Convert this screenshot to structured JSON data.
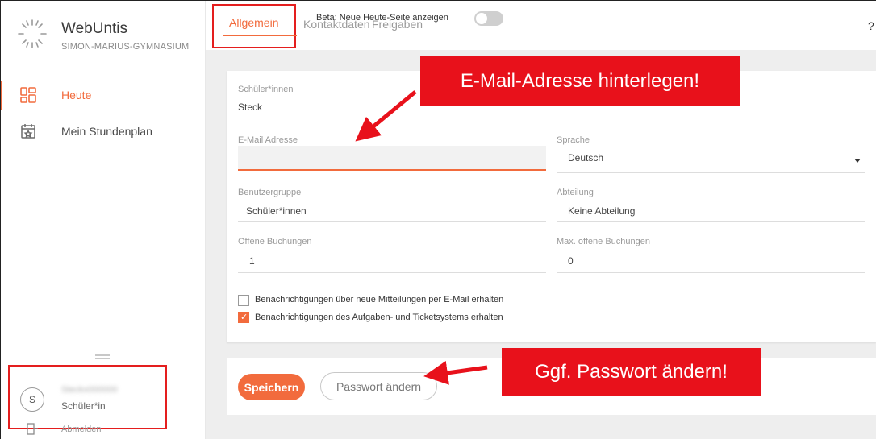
{
  "app": {
    "name": "WebUntis",
    "school": "SIMON-MARIUS-GYMNASIUM"
  },
  "sidebar": {
    "items": [
      {
        "label": "Heute",
        "icon": "dashboard-icon",
        "active": true
      },
      {
        "label": "Mein Stundenplan",
        "icon": "calendar-icon",
        "active": false
      }
    ],
    "user": {
      "avatar_initial": "S",
      "role": "Schüler*in",
      "logout_label": "Abmelden"
    }
  },
  "tabs": [
    {
      "label": "Allgemein",
      "active": true
    },
    {
      "label": "Kontaktdaten",
      "active": false
    },
    {
      "label": "Freigaben",
      "active": false
    }
  ],
  "beta": {
    "label": "Beta: Neue Heute-Seite anzeigen",
    "enabled": false
  },
  "form": {
    "student": {
      "label": "Schüler*innen",
      "value": "Steck"
    },
    "email": {
      "label": "E-Mail Adresse",
      "value": ""
    },
    "language": {
      "label": "Sprache",
      "value": "Deutsch"
    },
    "user_group": {
      "label": "Benutzergruppe",
      "value": "Schüler*innen"
    },
    "department": {
      "label": "Abteilung",
      "value": "Keine Abteilung"
    },
    "open_bookings": {
      "label": "Offene Buchungen",
      "value": "1"
    },
    "max_open_bookings": {
      "label": "Max. offene Buchungen",
      "value": "0"
    },
    "notify_messages": {
      "label": "Benachrichtigungen über neue Mitteilungen per E-Mail erhalten",
      "checked": false
    },
    "notify_tickets": {
      "label": "Benachrichtigungen des Aufgaben- und Ticketsystems erhalten",
      "checked": true
    }
  },
  "actions": {
    "save_label": "Speichern",
    "change_password_label": "Passwort ändern"
  },
  "annotations": {
    "email_hint": "E-Mail-Adresse hinterlegen!",
    "password_hint": "Ggf. Passwort ändern!"
  },
  "colors": {
    "accent": "#f26b3d",
    "highlight_red": "#e8111b"
  }
}
